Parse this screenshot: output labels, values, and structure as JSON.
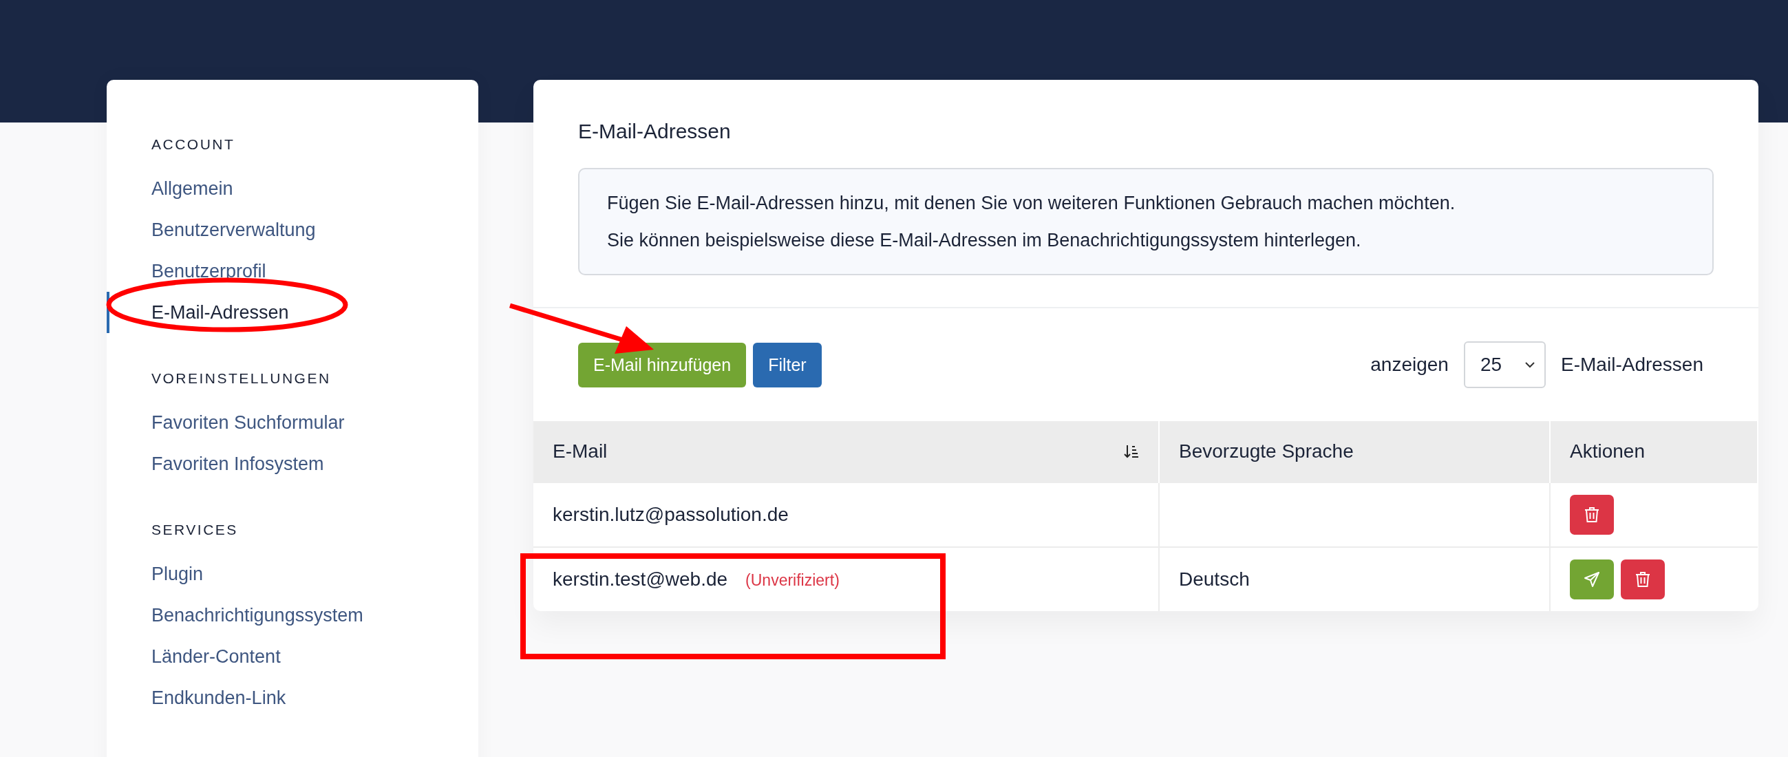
{
  "sidebar": {
    "sections": [
      {
        "heading": "ACCOUNT",
        "items": [
          {
            "label": "Allgemein",
            "selected": false
          },
          {
            "label": "Benutzerverwaltung",
            "selected": false
          },
          {
            "label": "Benutzerprofil",
            "selected": false
          },
          {
            "label": "E-Mail-Adressen",
            "selected": true
          }
        ]
      },
      {
        "heading": "VOREINSTELLUNGEN",
        "items": [
          {
            "label": "Favoriten Suchformular",
            "selected": false
          },
          {
            "label": "Favoriten Infosystem",
            "selected": false
          }
        ]
      },
      {
        "heading": "SERVICES",
        "items": [
          {
            "label": "Plugin",
            "selected": false
          },
          {
            "label": "Benachrichtigungssystem",
            "selected": false
          },
          {
            "label": "Länder-Content",
            "selected": false
          },
          {
            "label": "Endkunden-Link",
            "selected": false
          }
        ]
      }
    ]
  },
  "main": {
    "title": "E-Mail-Adressen",
    "info": [
      "Fügen Sie E-Mail-Adressen hinzu, mit denen Sie von weiteren Funktionen Gebrauch machen möchten.",
      "Sie können beispielsweise diese E-Mail-Adressen im Benachrichtigungssystem hinterlegen."
    ],
    "buttons": [
      {
        "label": "E-Mail hinzufügen",
        "kind": "add"
      },
      {
        "label": "Filter",
        "kind": "filter"
      }
    ],
    "page_size": {
      "prefix": "anzeigen",
      "value": "25",
      "suffix": "E-Mail-Adressen"
    },
    "table": {
      "columns": [
        {
          "label": "E-Mail",
          "sorted": true
        },
        {
          "label": "Bevorzugte Sprache",
          "sorted": false
        },
        {
          "label": "Aktionen",
          "sorted": false
        }
      ],
      "rows": [
        {
          "email": "kerstin.lutz@passolution.de",
          "language": "",
          "actions": [
            {
              "kind": "delete"
            }
          ]
        },
        {
          "email": "kerstin.test@web.de",
          "note": "(Unverifiziert)",
          "language": "Deutsch",
          "actions": [
            {
              "kind": "send"
            },
            {
              "kind": "delete"
            }
          ]
        }
      ]
    }
  }
}
